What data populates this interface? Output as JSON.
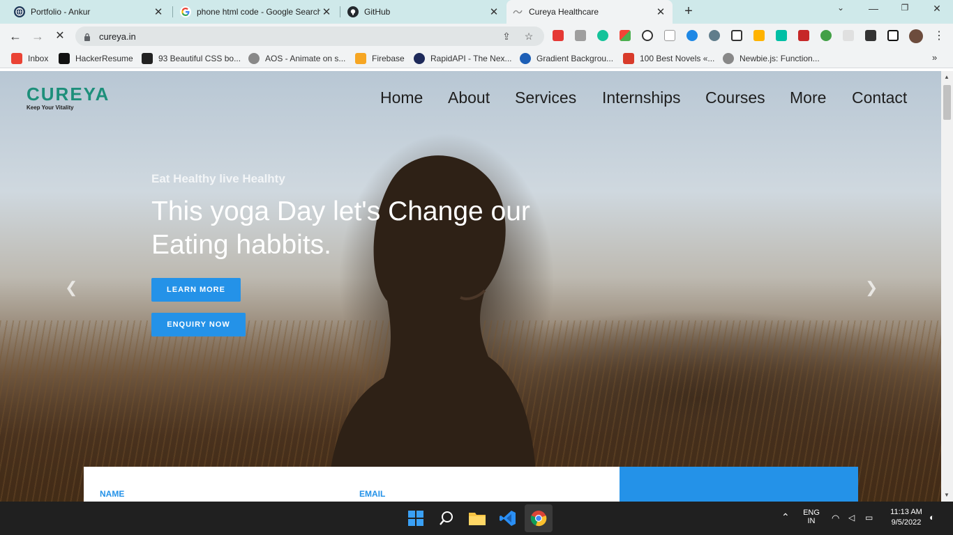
{
  "browser": {
    "tabs": [
      {
        "title": "Portfolio - Ankur",
        "icon": "globe-icon"
      },
      {
        "title": "phone html code - Google Search",
        "icon": "google-icon"
      },
      {
        "title": "GitHub",
        "icon": "github-icon"
      },
      {
        "title": "Cureya Healthcare",
        "icon": "cureya-favicon",
        "active": true
      }
    ],
    "url": "cureya.in",
    "bookmarks": [
      {
        "label": "Inbox",
        "icon": "gmail-icon",
        "color": "#ea4335"
      },
      {
        "label": "HackerResume",
        "icon": "hackerresume-icon",
        "color": "#111111"
      },
      {
        "label": "93 Beautiful CSS bo...",
        "icon": "css-icon",
        "color": "#222222"
      },
      {
        "label": "AOS - Animate on s...",
        "icon": "aos-icon",
        "color": "#888888"
      },
      {
        "label": "Firebase",
        "icon": "firebase-icon",
        "color": "#f6a623"
      },
      {
        "label": "RapidAPI - The Nex...",
        "icon": "rapidapi-icon",
        "color": "#1e2a5a"
      },
      {
        "label": "Gradient Backgrou...",
        "icon": "gradient-icon",
        "color": "#1d5fb6"
      },
      {
        "label": "100 Best Novels «...",
        "icon": "pdf-icon",
        "color": "#d83b2b"
      },
      {
        "label": "Newbie.js: Function...",
        "icon": "globe-icon",
        "color": "#888888"
      }
    ]
  },
  "site": {
    "brand": "CUREYA",
    "tagline": "Keep Your Vitality",
    "nav": [
      "Home",
      "About",
      "Services",
      "Internships",
      "Courses",
      "More",
      "Contact"
    ],
    "hero": {
      "eyebrow": "Eat Healthy live Healhty",
      "headline": "This yoga Day let's Change our Eating habbits.",
      "learn_more": "LEARN MORE",
      "enquiry": "ENQUIRY NOW"
    },
    "form": {
      "name_label": "NAME",
      "email_label": "EMAIL"
    },
    "colors": {
      "accent": "#2492e8",
      "brand": "#1d8f7a"
    }
  },
  "taskbar": {
    "lang": "ENG",
    "region": "IN",
    "time": "11:13 AM",
    "date": "9/5/2022"
  }
}
